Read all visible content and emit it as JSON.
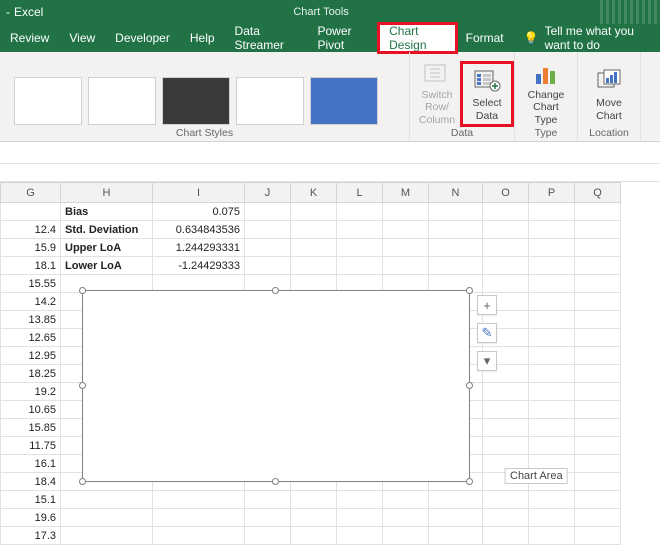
{
  "titlebar": {
    "app": "Excel",
    "tools": "Chart Tools"
  },
  "tabs": {
    "review": "Review",
    "view": "View",
    "developer": "Developer",
    "help": "Help",
    "datastreamer": "Data Streamer",
    "powerpivot": "Power Pivot",
    "chartdesign": "Chart Design",
    "format": "Format",
    "tellme": "Tell me what you want to do"
  },
  "ribbon": {
    "styles_label": "Chart Styles",
    "switchrow": "Switch Row/\nColumn",
    "selectdata": "Select\nData",
    "data_label": "Data",
    "changetype": "Change\nChart Type",
    "type_label": "Type",
    "movechart": "Move\nChart",
    "location_label": "Location"
  },
  "cols": [
    "G",
    "H",
    "I",
    "J",
    "K",
    "L",
    "M",
    "N",
    "O",
    "P",
    "Q"
  ],
  "colG_values": [
    "",
    "12.4",
    "15.9",
    "18.1",
    "15.55",
    "14.2",
    "13.85",
    "12.65",
    "12.95",
    "18.25",
    "19.2",
    "10.65",
    "15.85",
    "11.75",
    "16.1",
    "18.4",
    "15.1",
    "19.6",
    "17.3"
  ],
  "stats": {
    "bias_l": "Bias",
    "bias_v": "0.075",
    "sd_l": "Std. Deviation",
    "sd_v": "0.634843536",
    "uloa_l": "Upper LoA",
    "uloa_v": "1.244293331",
    "lloa_l": "Lower LoA",
    "lloa_v": "-1.24429333"
  },
  "chart": {
    "tooltip": "Chart Area"
  },
  "side": {
    "plus": "+",
    "brush": "✎",
    "filter": "▾"
  }
}
